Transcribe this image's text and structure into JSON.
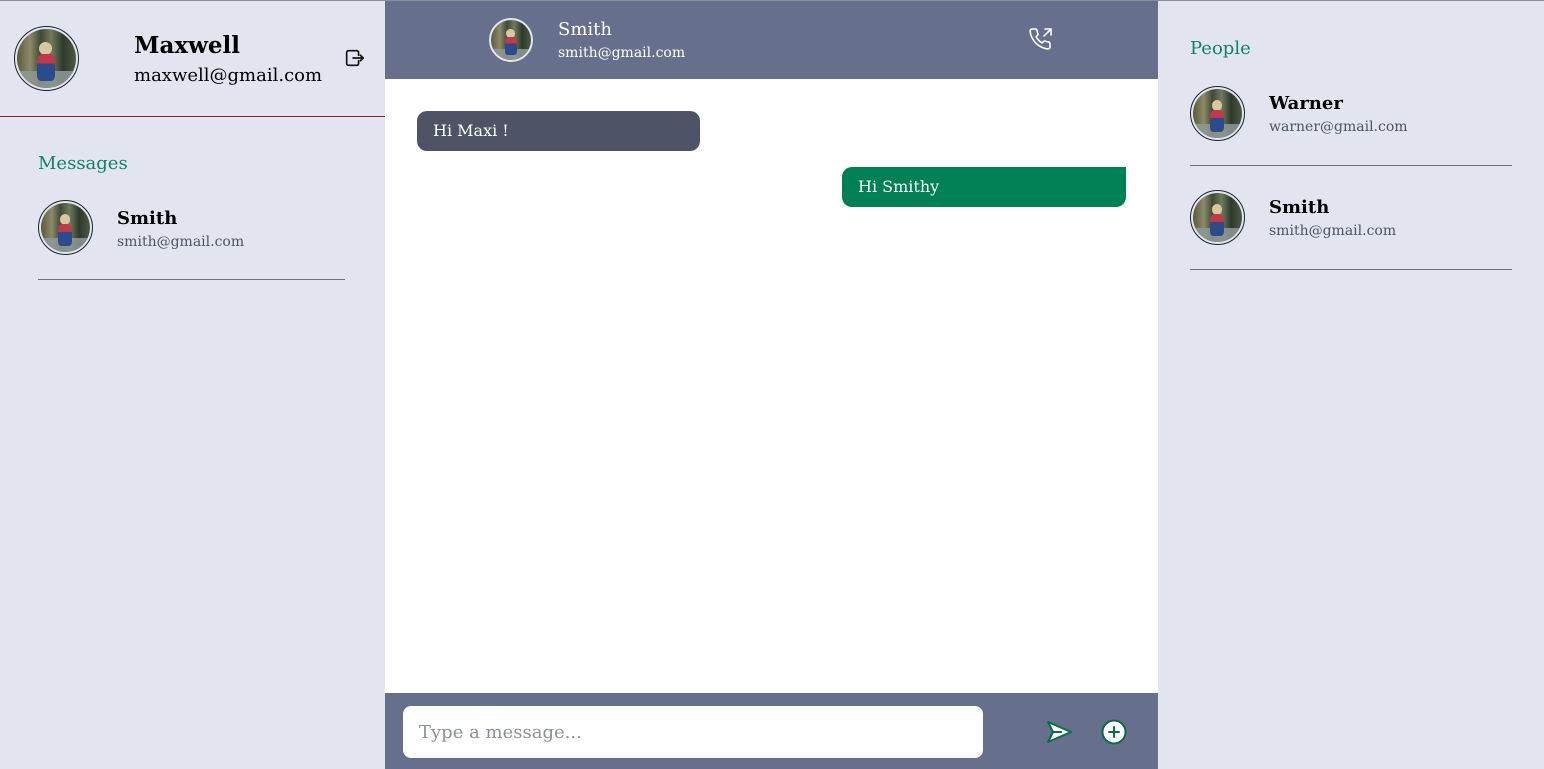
{
  "current_user": {
    "name": "Maxwell",
    "email": "maxwell@gmail.com",
    "logout_icon": "logout-icon"
  },
  "messages_section": {
    "title": "Messages",
    "items": [
      {
        "name": "Smith",
        "email": "smith@gmail.com"
      }
    ]
  },
  "chat": {
    "header": {
      "name": "Smith",
      "email": "smith@gmail.com",
      "call_icon": "phone-outgoing-icon"
    },
    "messages": [
      {
        "direction": "incoming",
        "text": "Hi Maxi !"
      },
      {
        "direction": "outgoing",
        "text": "Hi Smithy"
      }
    ],
    "composer": {
      "placeholder": "Type a message...",
      "value": "",
      "send_icon": "send-icon",
      "add_icon": "add-circle-icon"
    }
  },
  "people_section": {
    "title": "People",
    "items": [
      {
        "name": "Warner",
        "email": "warner@gmail.com"
      },
      {
        "name": "Smith",
        "email": "smith@gmail.com"
      }
    ]
  },
  "colors": {
    "accent_text": "#12806b",
    "header_bg": "#66708c",
    "incoming_bubble": "#4e5465",
    "outgoing_bubble": "#008055",
    "sidebar_bg": "#e2e5f0"
  }
}
